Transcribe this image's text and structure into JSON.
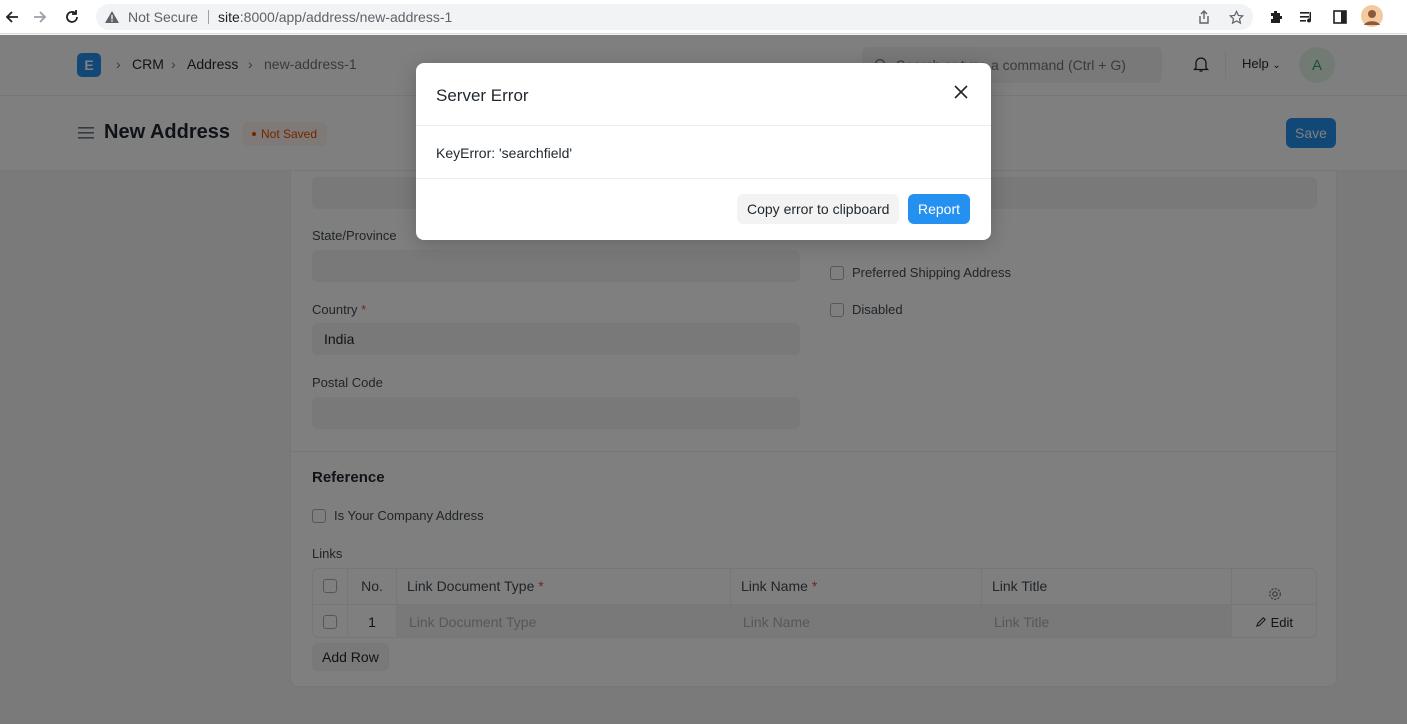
{
  "browser": {
    "security_label": "Not Secure",
    "url_host": "site",
    "url_rest": ":8000/app/address/new-address-1"
  },
  "navbar": {
    "logo_letter": "E",
    "breadcrumbs": [
      "CRM",
      "Address",
      "new-address-1"
    ],
    "search_placeholder": "Search or type a command (Ctrl + G)",
    "help_label": "Help",
    "avatar_letter": "A"
  },
  "page": {
    "title": "New Address",
    "status": "Not Saved",
    "save_label": "Save"
  },
  "form": {
    "state_label": "State/Province",
    "state_value": "",
    "country_label": "Country",
    "country_required": "*",
    "country_value": "India",
    "postal_label": "Postal Code",
    "postal_value": "",
    "preferred_shipping_label": "Preferred Shipping Address",
    "disabled_label": "Disabled",
    "reference_title": "Reference",
    "is_company_label": "Is Your Company Address",
    "links_label": "Links"
  },
  "grid": {
    "columns": {
      "no": "No.",
      "doctype": "Link Document Type",
      "name": "Link Name",
      "title": "Link Title",
      "required_mark": "*"
    },
    "rows": [
      {
        "no": "1",
        "doctype": "Link Document Type",
        "name": "Link Name",
        "title": "Link Title",
        "edit": "Edit"
      }
    ],
    "add_row_label": "Add Row"
  },
  "modal": {
    "title": "Server Error",
    "message": "KeyError: 'searchfield'",
    "copy_label": "Copy error to clipboard",
    "report_label": "Report"
  },
  "colors": {
    "primary": "#2490ef",
    "not_saved": "#e24c00",
    "required": "#e24c4c"
  }
}
